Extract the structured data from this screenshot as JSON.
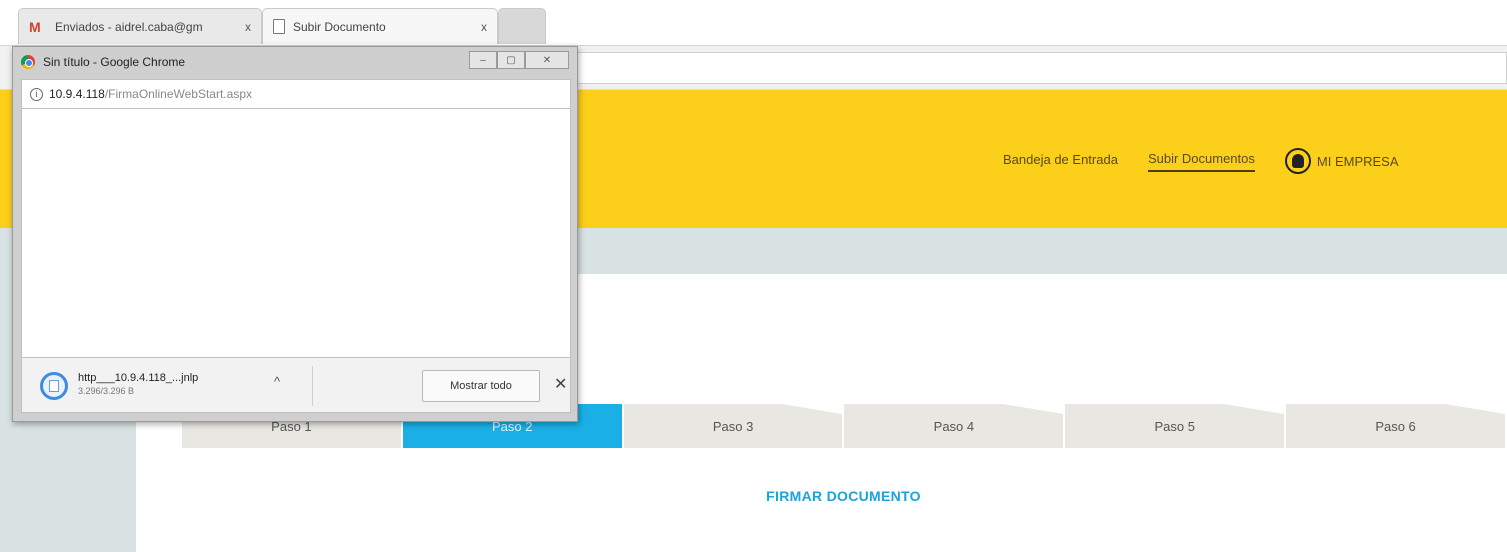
{
  "browser": {
    "tabs": [
      {
        "label": "Enviados - aidrel.caba@gm",
        "icon": "gmail-icon"
      },
      {
        "label": "Subir Documento",
        "icon": "document-icon"
      }
    ],
    "close_glyph": "x"
  },
  "site": {
    "nav": {
      "inbox": "Bandeja de Entrada",
      "upload": "Subir Documentos",
      "company": "MI EMPRESA"
    },
    "steps": [
      "Paso 1",
      "Paso 2",
      "Paso 3",
      "Paso 4",
      "Paso 5",
      "Paso 6"
    ],
    "active_step": 2,
    "section_title": "FIRMAR DOCUMENTO",
    "colors": {
      "header": "#fccf1a",
      "active_step": "#1ab0e6",
      "title": "#1aa3dc"
    }
  },
  "popup": {
    "title": "Sin título - Google Chrome",
    "url_host": "10.9.4.118",
    "url_path": "/FirmaOnlineWebStart.aspx",
    "download": {
      "filename": "http___10.9.4.118_...jnlp",
      "size": "3.296/3.296 B",
      "show_all": "Mostrar todo"
    }
  }
}
